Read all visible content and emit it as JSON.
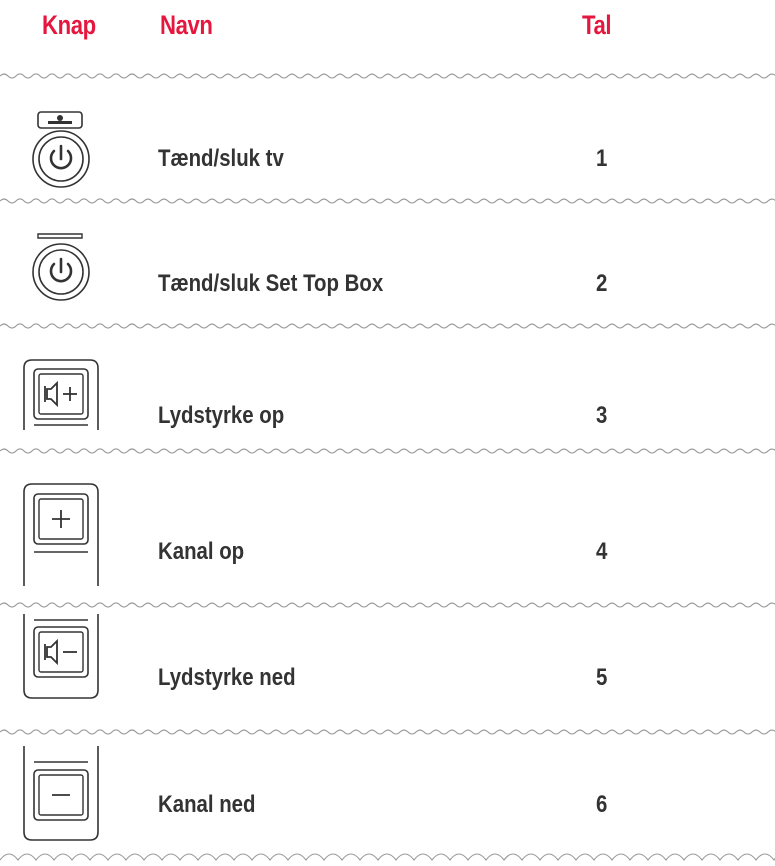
{
  "header": {
    "knap": "Knap",
    "navn": "Navn",
    "tal": "Tal"
  },
  "rows": [
    {
      "icon": "power-button-tv-icon",
      "name": "Tænd/sluk tv",
      "num": "1"
    },
    {
      "icon": "power-button-stb-icon",
      "name": "Tænd/sluk Set Top Box",
      "num": "2"
    },
    {
      "icon": "volume-up-button-icon",
      "name": "Lydstyrke op",
      "num": "3"
    },
    {
      "icon": "channel-up-button-icon",
      "name": "Kanal op",
      "num": "4"
    },
    {
      "icon": "volume-down-button-icon",
      "name": "Lydstyrke ned",
      "num": "5"
    },
    {
      "icon": "channel-down-button-icon",
      "name": "Kanal ned",
      "num": "6"
    }
  ],
  "colors": {
    "accent": "#e5173f",
    "text": "#333333",
    "divider": "#999999"
  }
}
